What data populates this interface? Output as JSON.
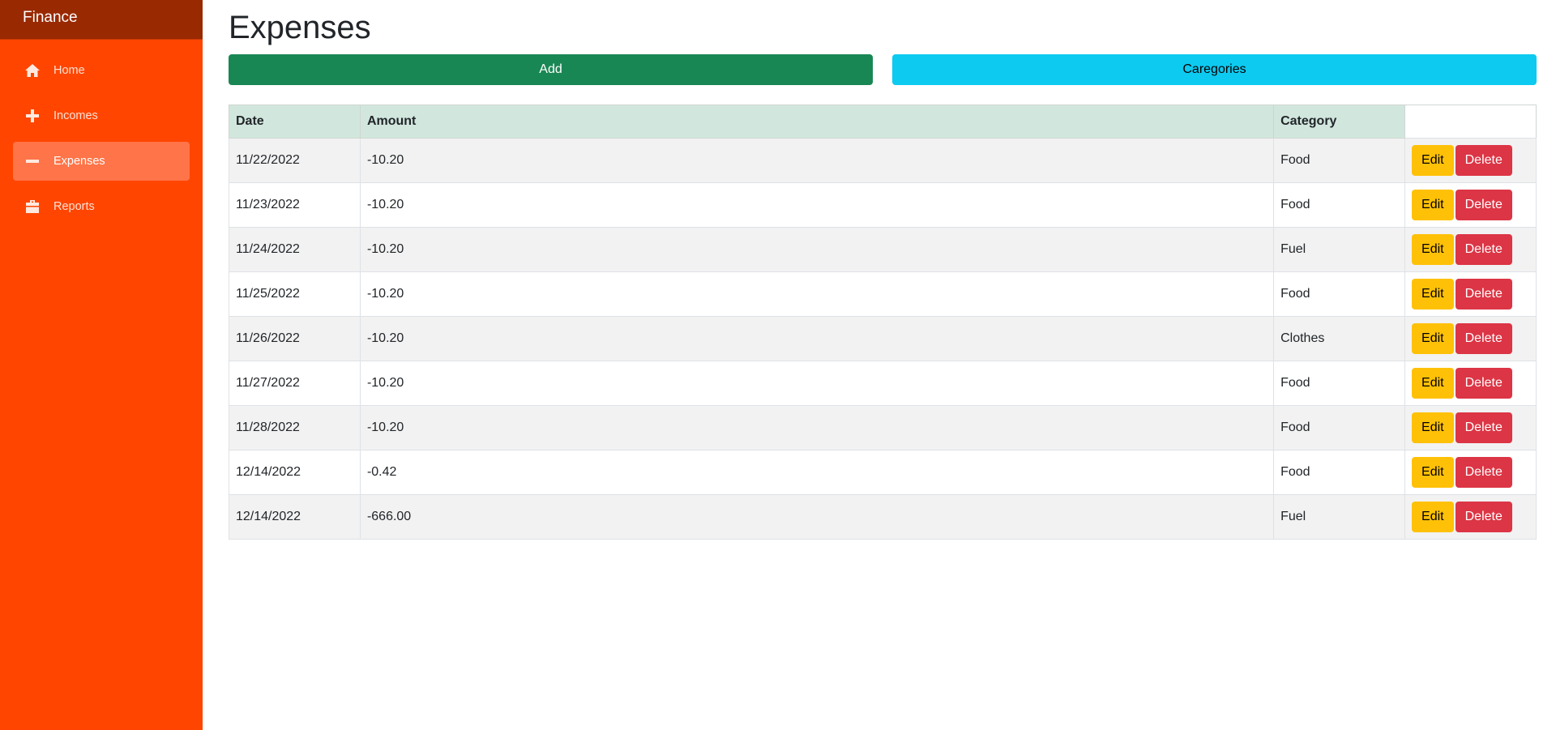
{
  "sidebar": {
    "brand": "Finance",
    "items": [
      {
        "label": "Home",
        "icon": "home-icon"
      },
      {
        "label": "Incomes",
        "icon": "plus-icon"
      },
      {
        "label": "Expenses",
        "icon": "minus-icon"
      },
      {
        "label": "Reports",
        "icon": "briefcase-icon"
      }
    ],
    "active": "Expenses"
  },
  "page": {
    "title": "Expenses",
    "add_label": "Add",
    "categories_label": "Caregories"
  },
  "table": {
    "headers": {
      "date": "Date",
      "amount": "Amount",
      "category": "Category"
    },
    "edit_label": "Edit",
    "delete_label": "Delete",
    "rows": [
      {
        "date": "11/22/2022",
        "amount": "-10.20",
        "category": "Food"
      },
      {
        "date": "11/23/2022",
        "amount": "-10.20",
        "category": "Food"
      },
      {
        "date": "11/24/2022",
        "amount": "-10.20",
        "category": "Fuel"
      },
      {
        "date": "11/25/2022",
        "amount": "-10.20",
        "category": "Food"
      },
      {
        "date": "11/26/2022",
        "amount": "-10.20",
        "category": "Clothes"
      },
      {
        "date": "11/27/2022",
        "amount": "-10.20",
        "category": "Food"
      },
      {
        "date": "11/28/2022",
        "amount": "-10.20",
        "category": "Food"
      },
      {
        "date": "12/14/2022",
        "amount": "-0.42",
        "category": "Food"
      },
      {
        "date": "12/14/2022",
        "amount": "-666.00",
        "category": "Fuel"
      }
    ]
  },
  "colors": {
    "sidebar": "#ff4500",
    "brand_bar": "#992900",
    "active_item": "#ff7448",
    "add": "#198754",
    "categories": "#0dcaf0",
    "edit": "#ffc107",
    "delete": "#dc3545",
    "header_row": "#d1e7dd"
  }
}
